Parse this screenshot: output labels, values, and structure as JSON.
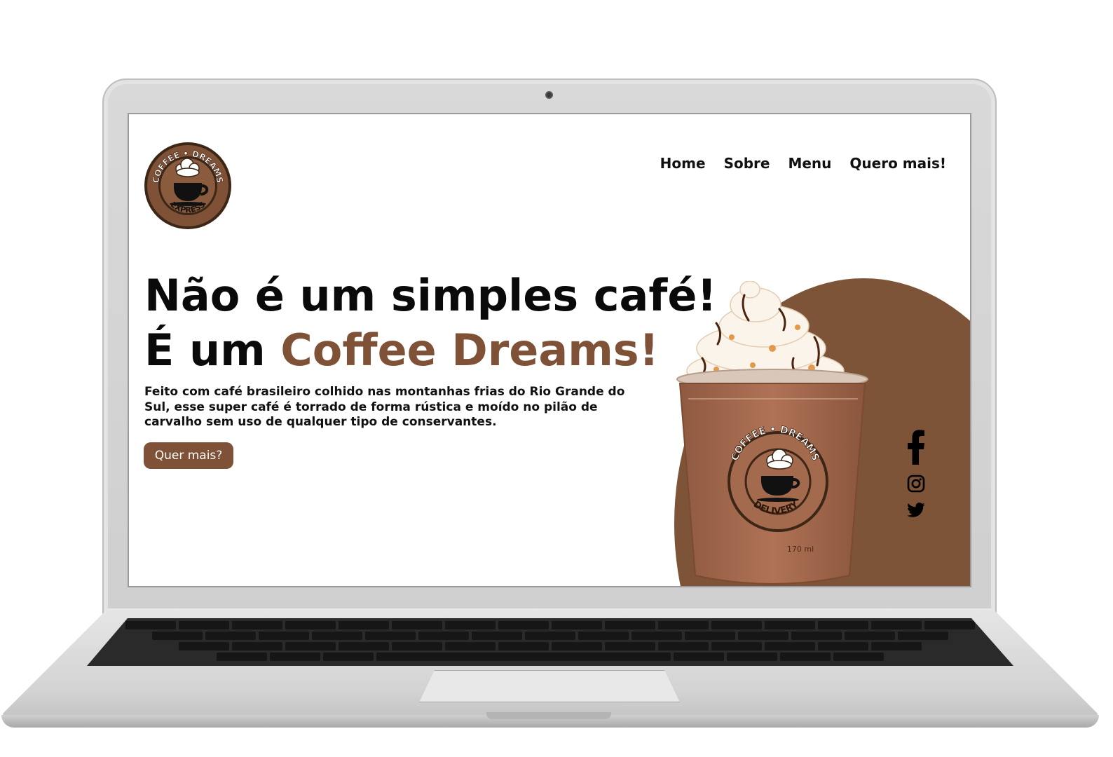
{
  "site": {
    "logo": {
      "top_text": "COFFEE • DREAMS",
      "bottom_text": "EXPRESS"
    },
    "nav": {
      "items": [
        {
          "label": "Home"
        },
        {
          "label": "Sobre"
        },
        {
          "label": "Menu"
        },
        {
          "label": "Quero mais!"
        }
      ]
    },
    "hero": {
      "line1": "Não é um simples café!",
      "line2_prefix": "É um ",
      "line2_brand": "Coffee Dreams!",
      "description": "Feito com café brasileiro colhido nas montanhas frias do Rio Grande do Sul, esse super café é torrado de forma rústica e moído no pilão de carvalho sem uso de qualquer tipo de conservantes.",
      "cta_label": "Quer mais?"
    },
    "product_image": {
      "cup_top_text": "COFFEE • DREAMS",
      "cup_bottom_text": "DELIVERY",
      "volume": "170 ml"
    },
    "social": [
      "facebook-icon",
      "instagram-icon",
      "twitter-icon"
    ],
    "colors": {
      "brand_brown": "#7f5136",
      "text": "#111111",
      "background": "#ffffff"
    }
  }
}
